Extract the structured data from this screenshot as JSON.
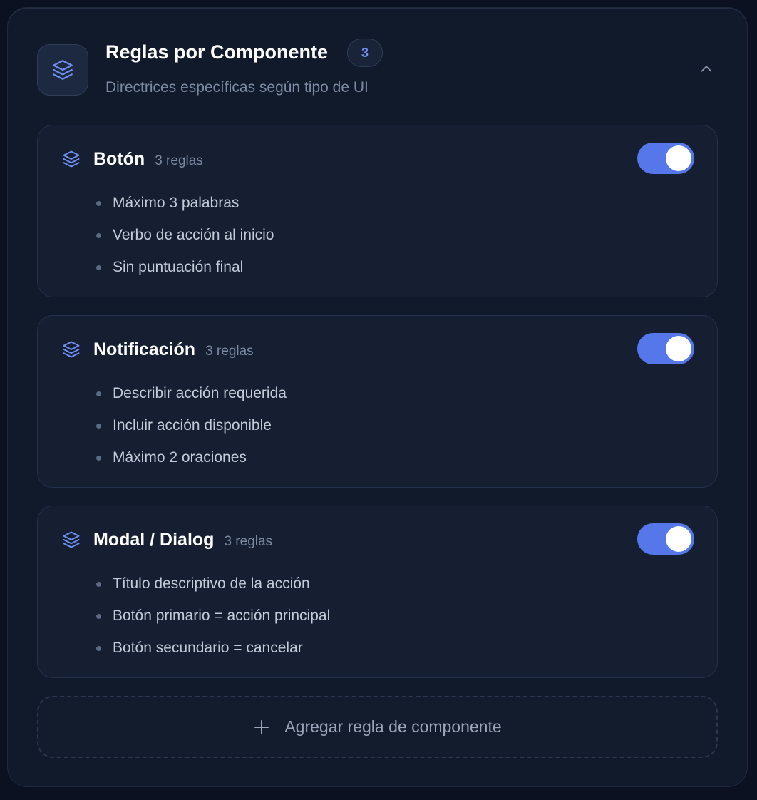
{
  "header": {
    "title": "Reglas por Componente",
    "count": "3",
    "subtitle": "Directrices específicas según tipo de UI",
    "icon": "layers-icon",
    "collapse_icon": "chevron-up-icon"
  },
  "components": [
    {
      "name": "Botón",
      "count_label": "3 reglas",
      "enabled": true,
      "rules": [
        "Máximo 3 palabras",
        "Verbo de acción al inicio",
        "Sin puntuación final"
      ]
    },
    {
      "name": "Notificación",
      "count_label": "3 reglas",
      "enabled": true,
      "rules": [
        "Describir acción requerida",
        "Incluir acción disponible",
        "Máximo 2 oraciones"
      ]
    },
    {
      "name": "Modal / Dialog",
      "count_label": "3 reglas",
      "enabled": true,
      "rules": [
        "Título descriptivo de la acción",
        "Botón primario = acción principal",
        "Botón secundario = cancelar"
      ]
    }
  ],
  "add_button": {
    "label": "Agregar regla de componente",
    "icon": "plus-icon"
  },
  "colors": {
    "accent": "#5577ea",
    "background": "#111a2b",
    "card": "#151f31",
    "muted_text": "#7d8aa3"
  }
}
